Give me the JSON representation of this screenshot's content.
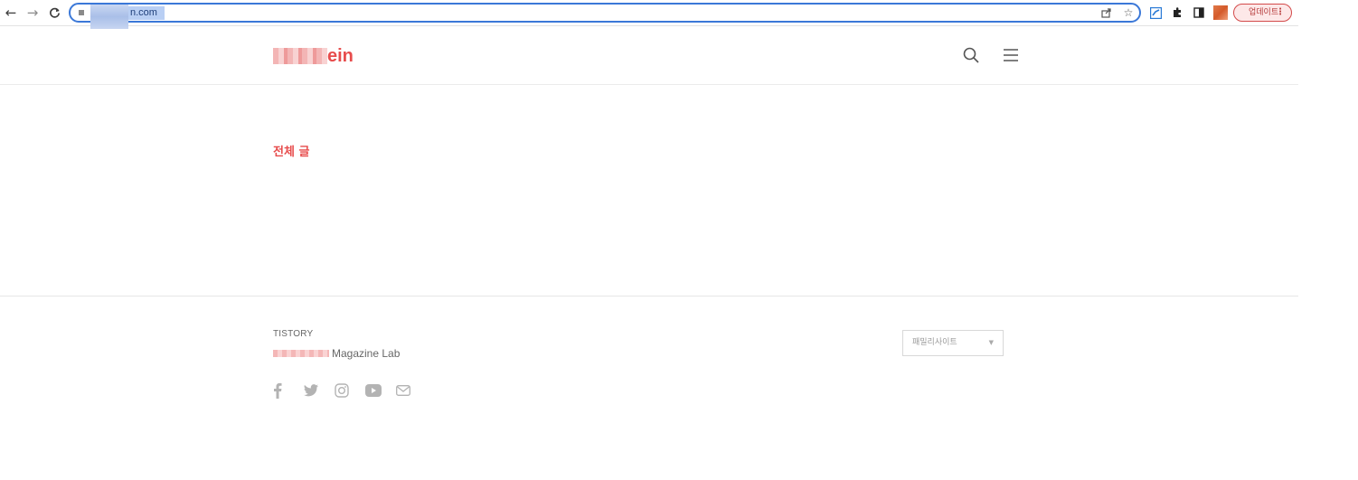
{
  "browser": {
    "url": "n.com",
    "update_label": "업데이트",
    "menu_dots": "⋮",
    "icons": [
      "back-icon",
      "forward-icon",
      "reload-icon",
      "share-icon",
      "star-icon",
      "extension-blue-icon",
      "puzzle-icon",
      "sidepanel-icon",
      "profile-avatar"
    ]
  },
  "header": {
    "logo_text": "ein",
    "icons": [
      "search-icon",
      "menu-icon"
    ]
  },
  "main": {
    "category_title": "전체 글"
  },
  "footer": {
    "brand": "TISTORY",
    "tagline": "Magazine Lab",
    "social_icons": [
      "facebook-icon",
      "twitter-icon",
      "instagram-icon",
      "youtube-icon",
      "mail-icon"
    ],
    "family_site_label": "패밀리사이트",
    "family_site_caret": "▼"
  },
  "colors": {
    "accent": "#e74c4c",
    "omnibox_border": "#3b78d8",
    "text_muted": "#666666"
  }
}
